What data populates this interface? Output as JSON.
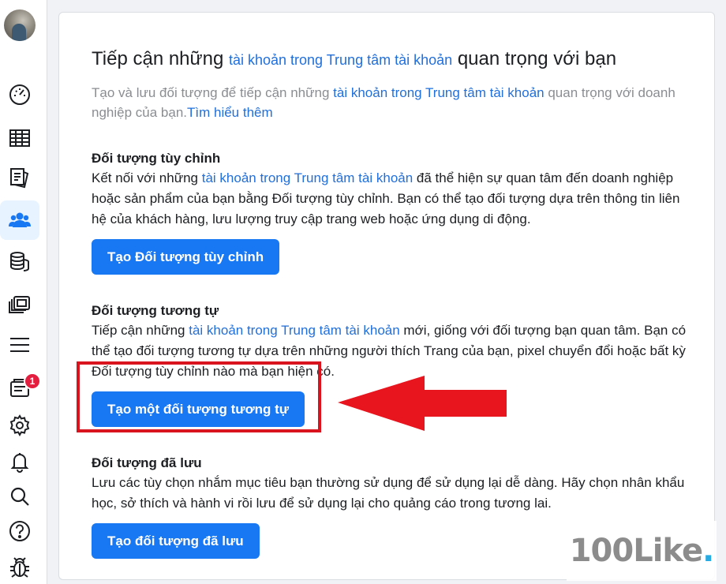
{
  "sidebar": {
    "items": [
      {
        "name": "dashboard-icon"
      },
      {
        "name": "table-icon"
      },
      {
        "name": "pages-icon"
      },
      {
        "name": "audiences-icon",
        "active": true
      },
      {
        "name": "database-icon"
      },
      {
        "name": "media-library-icon"
      },
      {
        "name": "menu-icon"
      },
      {
        "name": "notifications-icon",
        "badge": "1"
      },
      {
        "name": "settings-icon"
      },
      {
        "name": "bell-icon"
      },
      {
        "name": "search-icon"
      },
      {
        "name": "help-icon"
      },
      {
        "name": "bug-icon"
      }
    ]
  },
  "main": {
    "title_prefix": "Tiếp cận những",
    "title_link": "tài khoản trong Trung tâm tài khoản",
    "title_suffix": "quan trọng với bạn",
    "desc_prefix": "Tạo và lưu đối tượng để tiếp cận những",
    "desc_link": "tài khoản trong Trung tâm tài khoản",
    "desc_suffix": "quan trọng với doanh nghiệp của bạn.",
    "learn_more": "Tìm hiểu thêm",
    "sections": [
      {
        "title": "Đối tượng tùy chỉnh",
        "text_prefix": "Kết nối với những",
        "text_link": "tài khoản trong Trung tâm tài khoản",
        "text_suffix": "đã thể hiện sự quan tâm đến doanh nghiệp hoặc sản phẩm của bạn bằng Đối tượng tùy chỉnh. Bạn có thể tạo đối tượng dựa trên thông tin liên hệ của khách hàng, lưu lượng truy cập trang web hoặc ứng dụng di động.",
        "button": "Tạo Đối tượng tùy chỉnh"
      },
      {
        "title": "Đối tượng tương tự",
        "text_prefix": "Tiếp cận những",
        "text_link": "tài khoản trong Trung tâm tài khoản",
        "text_suffix": "mới, giống với đối tượng bạn quan tâm. Bạn có thể tạo đối tượng tương tự dựa trên những người thích Trang của bạn, pixel chuyển đổi hoặc bất kỳ Đối tượng tùy chỉnh nào mà bạn hiện có.",
        "button": "Tạo một đối tượng tương tự"
      },
      {
        "title": "Đối tượng đã lưu",
        "text_prefix": "Lưu các tùy chọn nhắm mục tiêu bạn thường sử dụng để sử dụng lại dễ dàng. Hãy chọn nhân khẩu học, sở thích và hành vi rồi lưu để sử dụng lại cho quảng cáo trong tương lai.",
        "text_link": "",
        "text_suffix": "",
        "button": "Tạo đối tượng đã lưu"
      }
    ]
  },
  "watermark": {
    "text": "100Like",
    "dot": "."
  },
  "colors": {
    "accent": "#1877f2",
    "link": "#216fdb",
    "annotation": "#e8141e"
  }
}
